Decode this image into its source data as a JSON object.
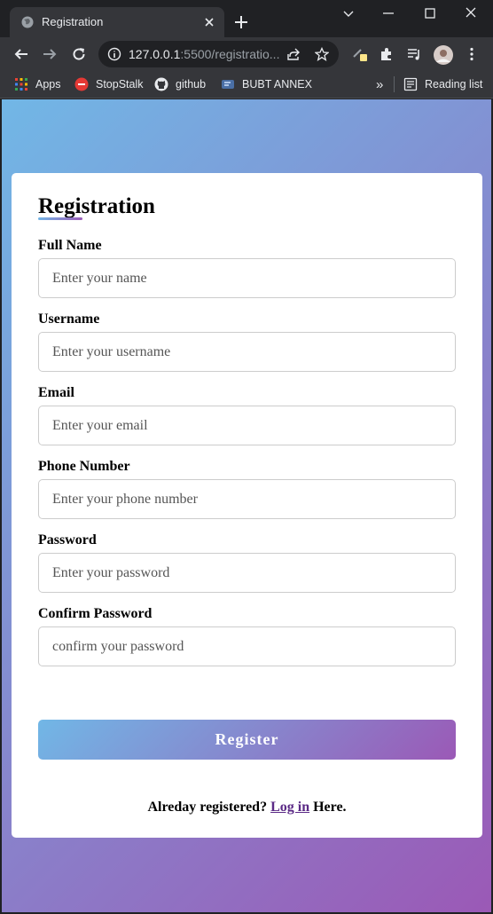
{
  "browser": {
    "tab_title": "Registration",
    "url_host": "127.0.0.1",
    "url_rest": ":5500/registratio...",
    "bookmarks": [
      {
        "label": "Apps",
        "icon": "apps-grid-icon"
      },
      {
        "label": "StopStalk",
        "icon": "stopstalk-icon"
      },
      {
        "label": "github",
        "icon": "github-icon"
      },
      {
        "label": "BUBT ANNEX",
        "icon": "bubt-icon"
      }
    ],
    "more_bookmarks": "»",
    "reading_list": "Reading list"
  },
  "form": {
    "title": "Registration",
    "fields": [
      {
        "label": "Full Name",
        "placeholder": "Enter your name"
      },
      {
        "label": "Username",
        "placeholder": "Enter your username"
      },
      {
        "label": "Email",
        "placeholder": "Enter your email"
      },
      {
        "label": "Phone Number",
        "placeholder": "Enter your phone number"
      },
      {
        "label": "Password",
        "placeholder": "Enter your password"
      },
      {
        "label": "Confirm Password",
        "placeholder": "confirm your password"
      }
    ],
    "submit_label": "Register",
    "login_prefix": "Alreday registered?",
    "login_link": "Log in",
    "login_suffix": "Here."
  },
  "colors": {
    "gradient_start": "#71b7e6",
    "gradient_end": "#9b59b6",
    "chrome_dark": "#202124",
    "chrome_toolbar": "#35363a"
  }
}
